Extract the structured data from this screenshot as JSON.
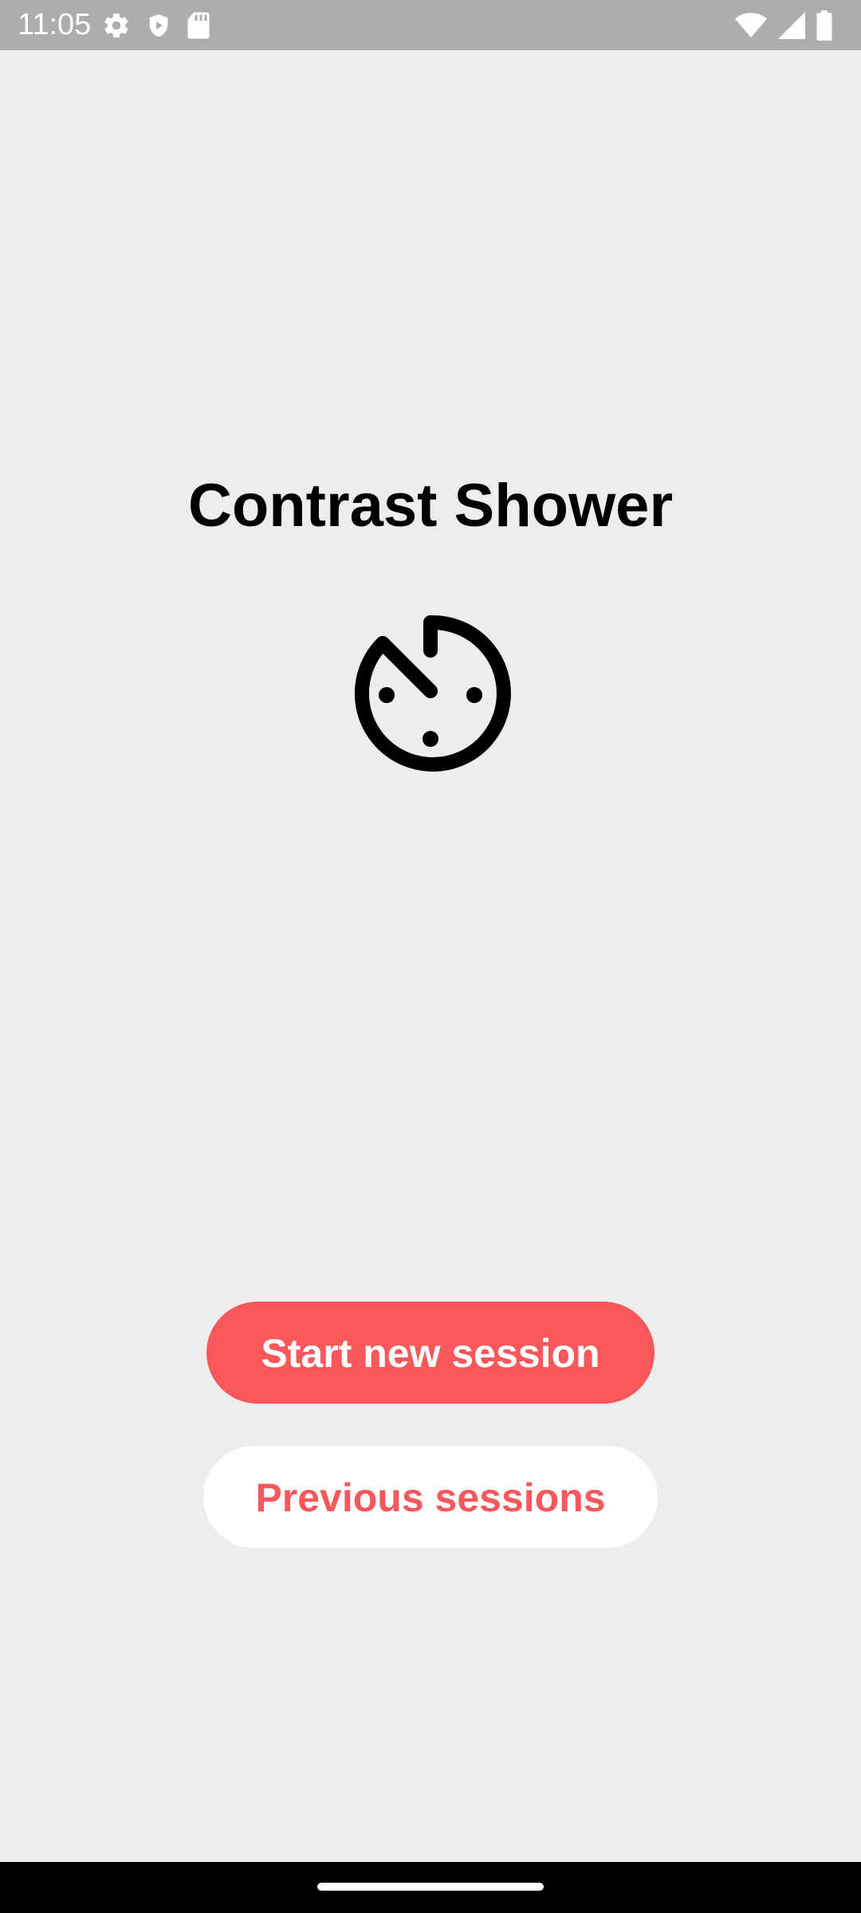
{
  "status_bar": {
    "time": "11:05",
    "left_icons": [
      "settings-icon",
      "shield-play-icon",
      "sd-card-icon"
    ],
    "right_icons": [
      "wifi-icon",
      "cellular-signal-icon",
      "battery-icon"
    ]
  },
  "app": {
    "title": "Contrast Shower",
    "logo_icon": "stopwatch-timer-icon"
  },
  "actions": {
    "start_label": "Start new session",
    "previous_label": "Previous sessions"
  },
  "colors": {
    "accent": "#f8585b",
    "background": "#ededed",
    "status_bar": "#adadad",
    "secondary_button_bg": "#ffffff",
    "text_primary": "#000000"
  }
}
